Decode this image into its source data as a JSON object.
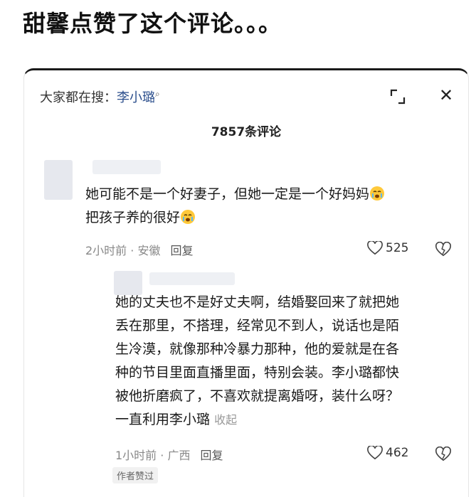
{
  "headline": "甜馨点赞了这个评论。。。",
  "search": {
    "prefix": "大家都在搜：",
    "term": "李小璐"
  },
  "header": {
    "comment_count": "7857条评论"
  },
  "comments": [
    {
      "line1": "她可能不是一个好妻子，但她一定是一个好妈妈",
      "line2": "把孩子养的很好",
      "time_location": "2小时前 · 安徽",
      "reply_label": "回复",
      "likes": "525"
    },
    {
      "lines": [
        "她的丈夫也不是好丈夫啊，结婚娶回来了就把她",
        "丢在那里，不搭理，经常见不到人，说话也是陌",
        "生冷漠，就像那种冷暴力那种，他的爱就是在各",
        "种的节目里面直播里面，特别会装。李小璐都快",
        "被他折磨疯了，不喜欢就提离婚呀，装什么呀？",
        "一直利用李小璐"
      ],
      "collapse_label": "收起",
      "time_location": "1小时前 · 广西",
      "reply_label": "回复",
      "likes": "462",
      "badge": "作者赞过"
    }
  ],
  "icons": {
    "search": "search-icon",
    "expand": "expand-icon",
    "close": "close-icon",
    "heart": "heart-icon",
    "dislike": "dislike-heart-icon",
    "emoji": "crying-face-emoji"
  }
}
